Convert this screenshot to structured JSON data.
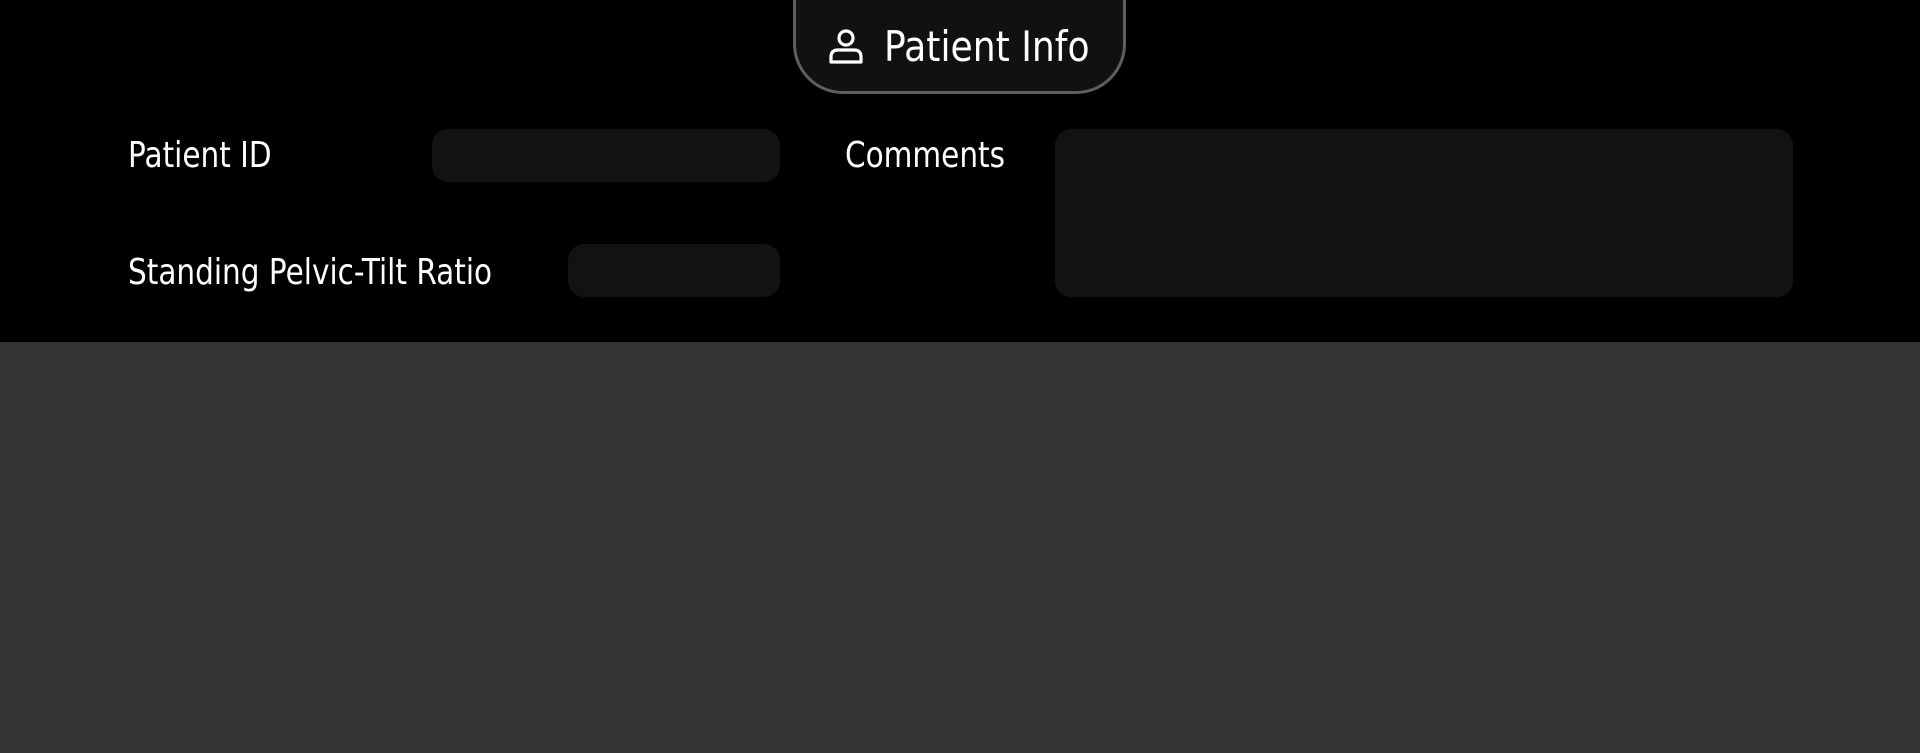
{
  "tab": {
    "label": "Patient Info",
    "icon": "user-icon"
  },
  "form": {
    "patient_id": {
      "label": "Patient ID",
      "value": "",
      "placeholder": ""
    },
    "pelvic_tilt_ratio": {
      "label": "Standing Pelvic-Tilt Ratio",
      "value": "",
      "placeholder": ""
    },
    "comments": {
      "label": "Comments",
      "value": "",
      "placeholder": ""
    }
  },
  "colors": {
    "panel_background": "#000000",
    "field_background": "#121212",
    "tab_border": "#5e5e5e",
    "lower_background": "#333333",
    "text": "#ffffff"
  }
}
